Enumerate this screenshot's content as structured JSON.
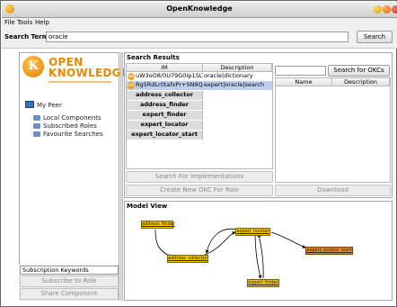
{
  "window": {
    "title": "OpenKnowledge"
  },
  "menu": {
    "items": [
      "File",
      "Tools",
      "Help"
    ]
  },
  "search": {
    "label": "Search Terms:",
    "value": "oracle",
    "button": "Search"
  },
  "logo": {
    "letter": "K",
    "line1": "OPEN",
    "line2": "KNOWLEDGE"
  },
  "tree": {
    "root": "My Peer",
    "children": [
      "Local Components",
      "Subscribed Roles",
      "Favourite Searches"
    ]
  },
  "left_bottom": {
    "field_label": "Subscription Keywords",
    "subscribe_button": "Subscribe to Role",
    "share_button": "Share Component"
  },
  "results": {
    "title": "Search Results",
    "columns": [
      "IM",
      "Description"
    ],
    "rows": [
      {
        "im": "uW3oO8/0U79G0Ip1SLT",
        "description": "oracle|dictionary",
        "selected": false
      },
      {
        "im": "Rg5RdLr0tafxPr+SN9Ql",
        "description": "expert|oracle|search",
        "selected": true
      }
    ],
    "roles": [
      "address_collector",
      "address_finder",
      "expert_finder",
      "expert_locator",
      "expert_locator_start"
    ],
    "search_impl_button": "Search For Implementations",
    "create_okc_button": "Create New OKC For Role"
  },
  "okc": {
    "search_value": "",
    "button": "Search for OKCs",
    "columns": [
      "Name",
      "Description"
    ],
    "download_button": "Download"
  },
  "model": {
    "title": "Model View",
    "nodes": [
      {
        "name": "address_finder",
        "color": "#f5c400"
      },
      {
        "name": "expert_locator",
        "color": "#f5c400"
      },
      {
        "name": "address_collector",
        "color": "#f5c400"
      },
      {
        "name": "expert_locator_start",
        "color": "#f08a00"
      },
      {
        "name": "expert_finder",
        "color": "#f5c400"
      }
    ]
  },
  "colors": {
    "accent": "#e88a00",
    "selected_row": "#bcd0ee",
    "window_bg": "#efefef"
  }
}
